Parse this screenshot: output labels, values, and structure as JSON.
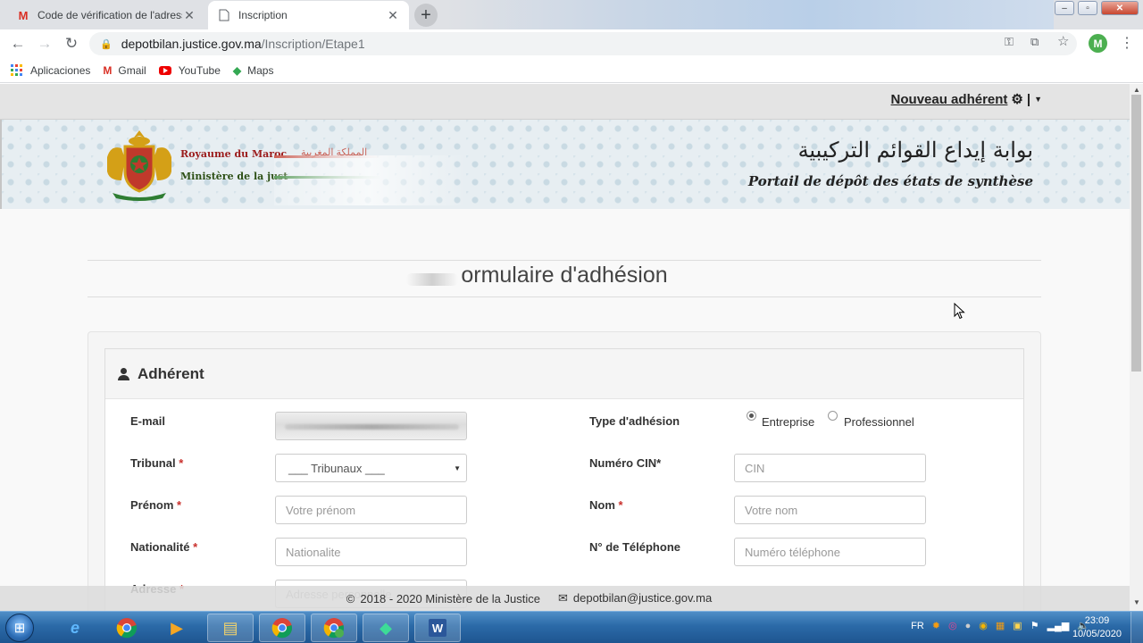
{
  "browser": {
    "tabs": [
      {
        "title": "Code de vérification de l'adresse",
        "icon": "gmail-icon",
        "active": false
      },
      {
        "title": "Inscription",
        "icon": "page-icon",
        "active": true
      }
    ],
    "url_host": "depotbilan.justice.gov.ma",
    "url_path": "/Inscription/Etape1",
    "profile_initial": "M",
    "bookmarks": [
      {
        "label": "Aplicaciones",
        "icon": "apps-grid-icon"
      },
      {
        "label": "Gmail",
        "icon": "gmail-icon"
      },
      {
        "label": "YouTube",
        "icon": "youtube-icon"
      },
      {
        "label": "Maps",
        "icon": "maps-icon"
      }
    ]
  },
  "site": {
    "user_menu_label": "Nouveau adhérent",
    "header": {
      "kingdom_fr": "Royaume du Maroc",
      "kingdom_ar": "المملكة المغربية",
      "ministry_fr": "Ministère de la just",
      "portal_ar": "بوابة إيداع القوائم التركيبية",
      "portal_fr": "Portail de dépôt des états de synthèse"
    },
    "form_title": "ormulaire d'adhésion",
    "panel_title": "Adhérent",
    "fields": {
      "email_label": "E-mail",
      "type_label": "Type d'adhésion",
      "type_options": [
        "Entreprise",
        "Professionnel"
      ],
      "type_selected": "Entreprise",
      "tribunal_label": "Tribunal",
      "tribunal_value": "___ Tribunaux ___",
      "cin_label": "Numéro CIN*",
      "cin_placeholder": "CIN",
      "prenom_label": "Prénom",
      "prenom_placeholder": "Votre prénom",
      "nom_label": "Nom",
      "nom_placeholder": "Votre nom",
      "nationalite_label": "Nationalité",
      "nationalite_placeholder": "Nationalite",
      "telephone_label": "N° de Téléphone",
      "telephone_placeholder": "Numéro téléphone",
      "adresse_label": "Adresse",
      "adresse_placeholder": "Adresse personnelle",
      "required_mark": "*"
    },
    "footer": {
      "copyright": "2018 - 2020 Ministère de la Justice",
      "email": "depotbilan@justice.gov.ma"
    }
  },
  "taskbar": {
    "language": "FR",
    "time": "23:09",
    "date": "10/05/2020",
    "apps": [
      "internet-explorer-icon",
      "chrome-icon",
      "media-player-icon",
      "file-explorer-icon",
      "chrome-icon",
      "chrome-profile-icon",
      "filmora-icon",
      "word-icon"
    ]
  }
}
